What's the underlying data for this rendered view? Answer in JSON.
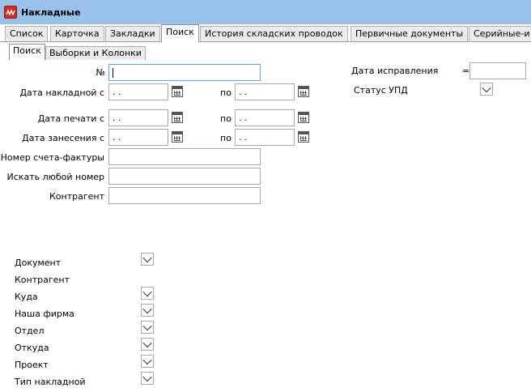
{
  "window": {
    "title": "Накладные"
  },
  "tabs": [
    "Список",
    "Карточка",
    "Закладки",
    "Поиск",
    "История складских проводок",
    "Первичные документы",
    "Серийные-и"
  ],
  "subtabs": [
    "Поиск",
    "Выборки и Колонки"
  ],
  "form": {
    "number_label": "№",
    "invoice_date_label": "Дата накладной с",
    "print_date_label": "Дата печати с",
    "entry_date_label": "Дата занесения с",
    "to_label": "по",
    "date_placeholder": " .  .",
    "invoice_number_label": "Номер счета-фактуры",
    "any_number_label": "Искать любой номер",
    "counterparty_label": "Контрагент",
    "correction_date_label": "Дата исправления",
    "correction_date_op": "=",
    "upd_status_label": "Статус УПД"
  },
  "filters": [
    "Документ",
    "Контрагент",
    "Куда",
    "Наша фирма",
    "Отдел",
    "Откуда",
    "Проект",
    "Тип накладной"
  ]
}
